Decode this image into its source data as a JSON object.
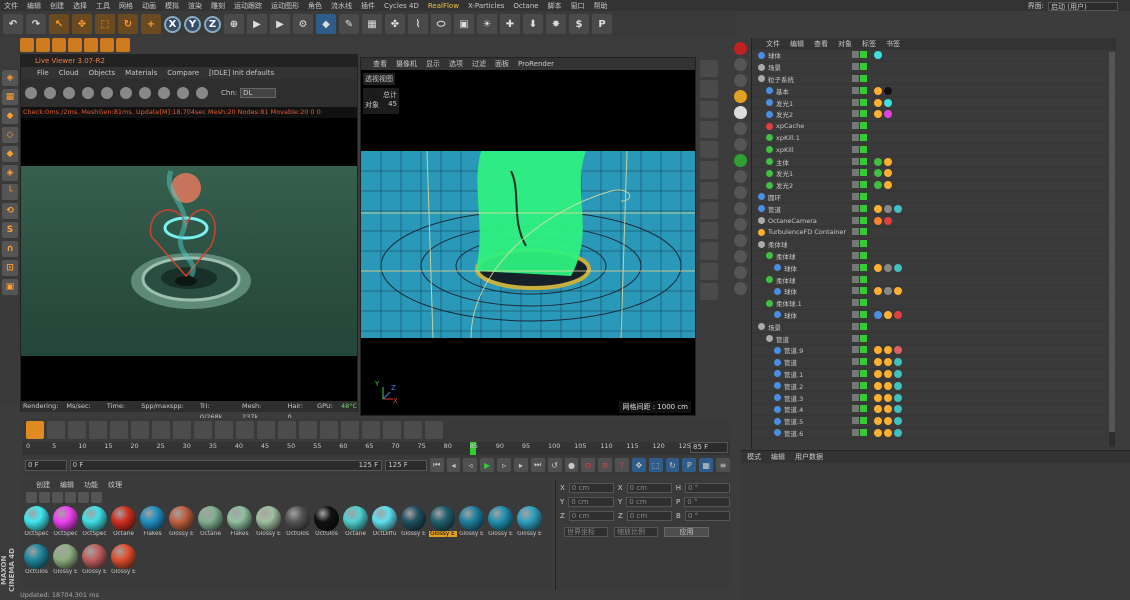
{
  "menubar": {
    "items": [
      "文件",
      "编辑",
      "创建",
      "选择",
      "工具",
      "网格",
      "动画",
      "模拟",
      "渲染",
      "雕刻",
      "运动跟踪",
      "运动图形",
      "角色",
      "流水线",
      "插件",
      "Cycles 4D",
      "RealFlow",
      "X-Particles",
      "Octane",
      "脚本",
      "窗口",
      "帮助"
    ],
    "highlight_index": 16,
    "layout_label": "界面:",
    "layout_value": "启动 (用户)"
  },
  "toolbar": {
    "axes": [
      "X",
      "Y",
      "Z"
    ]
  },
  "live_viewer": {
    "title": "Live Viewer 3.07-R2",
    "menu": [
      "File",
      "Cloud",
      "Objects",
      "Materials",
      "Compare",
      "[IDLE] Init defaults"
    ],
    "chn_label": "Chn:",
    "chn_value": "DL",
    "status": "Check:0ms./2ms. MeshGen:81ms. Update[M]:18.704sec Mesh:20 Nodes:81 Movable:20  0 0",
    "info": {
      "rendering": "Rendering:",
      "ms": "Ms/sec: ...",
      "time": "Time: ...",
      "spp": "Spp/maxspp: ...",
      "tri": "Tri: 0/268k",
      "mesh": "Mesh: 237k",
      "hair": "Hair: 0",
      "gpu": "GPU:",
      "temp": "48°C"
    }
  },
  "viewport": {
    "menu": [
      "查看",
      "摄像机",
      "显示",
      "选项",
      "过滤",
      "面板",
      "ProRender"
    ],
    "label": "透视视图",
    "hud_total": "总计",
    "hud_objects_label": "对象",
    "hud_objects_value": "45",
    "grid_spacing": "网格间距 : 1000 cm",
    "axis_x": "X",
    "axis_y": "Y",
    "axis_z": "Z"
  },
  "object_manager": {
    "menu": [
      "文件",
      "编辑",
      "查看",
      "对象",
      "标签",
      "书签"
    ],
    "rows": [
      {
        "name": "球体",
        "indent": 0,
        "icon": "#4a90e2",
        "tags": [
          "#40e0e0"
        ]
      },
      {
        "name": "场景",
        "indent": 0,
        "icon": "#aaaaaa",
        "tags": []
      },
      {
        "name": "粒子系统",
        "indent": 0,
        "icon": "#aaaaaa",
        "tags": []
      },
      {
        "name": "基本",
        "indent": 1,
        "icon": "#4a90e2",
        "tags": [
          "#ffb030",
          "#111111"
        ]
      },
      {
        "name": "发光1",
        "indent": 1,
        "icon": "#4a90e2",
        "tags": [
          "#ffb030",
          "#40e0e0"
        ]
      },
      {
        "name": "发光2",
        "indent": 1,
        "icon": "#4a90e2",
        "tags": [
          "#ffb030",
          "#e040e0"
        ]
      },
      {
        "name": "xpCache",
        "indent": 1,
        "icon": "#e04040",
        "tags": []
      },
      {
        "name": "xpKill.1",
        "indent": 1,
        "icon": "#40c040",
        "tags": []
      },
      {
        "name": "xpKill",
        "indent": 1,
        "icon": "#40c040",
        "tags": []
      },
      {
        "name": "主体",
        "indent": 1,
        "icon": "#40c040",
        "tags": [
          "#40c040",
          "#ffb030"
        ]
      },
      {
        "name": "发光1",
        "indent": 1,
        "icon": "#40c040",
        "tags": [
          "#40c040",
          "#ffb030"
        ]
      },
      {
        "name": "发光2",
        "indent": 1,
        "icon": "#40c040",
        "tags": [
          "#40c040",
          "#ffb030"
        ]
      },
      {
        "name": "圆环",
        "indent": 0,
        "icon": "#4a90e2",
        "tags": []
      },
      {
        "name": "管道",
        "indent": 0,
        "icon": "#4a90e2",
        "tags": [
          "#ffb030",
          "#888888",
          "#40c0c0"
        ]
      },
      {
        "name": "OctaneCamera",
        "indent": 0,
        "icon": "#aaaaaa",
        "tags": [
          "#ff8030",
          "#e04040"
        ]
      },
      {
        "name": "TurbulenceFD Container",
        "indent": 0,
        "icon": "#ffb030",
        "tags": []
      },
      {
        "name": "柔体球",
        "indent": 0,
        "icon": "#aaaaaa",
        "tags": []
      },
      {
        "name": "柔体球",
        "indent": 1,
        "icon": "#40c040",
        "tags": []
      },
      {
        "name": "球体",
        "indent": 2,
        "icon": "#4a90e2",
        "tags": [
          "#ffb030",
          "#888888",
          "#40c0c0"
        ]
      },
      {
        "name": "柔体球",
        "indent": 1,
        "icon": "#40c040",
        "tags": []
      },
      {
        "name": "球体",
        "indent": 2,
        "icon": "#4a90e2",
        "tags": [
          "#ffb030",
          "#888888",
          "#ffb030"
        ]
      },
      {
        "name": "柔体球.1",
        "indent": 1,
        "icon": "#40c040",
        "tags": []
      },
      {
        "name": "球体",
        "indent": 2,
        "icon": "#4a90e2",
        "tags": [
          "#4a90e2",
          "#ffb030",
          "#e04040"
        ]
      },
      {
        "name": "场景",
        "indent": 0,
        "icon": "#aaaaaa",
        "tags": []
      },
      {
        "name": "管道",
        "indent": 1,
        "icon": "#aaaaaa",
        "tags": []
      },
      {
        "name": "管道.9",
        "indent": 2,
        "icon": "#4a90e2",
        "tags": [
          "#ffb030",
          "#ffb030",
          "#e06060"
        ]
      },
      {
        "name": "管道",
        "indent": 2,
        "icon": "#4a90e2",
        "tags": [
          "#ffb030",
          "#ffb030",
          "#40c0c0"
        ]
      },
      {
        "name": "管道.1",
        "indent": 2,
        "icon": "#4a90e2",
        "tags": [
          "#ffb030",
          "#ffb030",
          "#40c0c0"
        ]
      },
      {
        "name": "管道.2",
        "indent": 2,
        "icon": "#4a90e2",
        "tags": [
          "#ffb030",
          "#ffb030",
          "#40c0c0"
        ]
      },
      {
        "name": "管道.3",
        "indent": 2,
        "icon": "#4a90e2",
        "tags": [
          "#ffb030",
          "#ffb030",
          "#40c0c0"
        ]
      },
      {
        "name": "管道.4",
        "indent": 2,
        "icon": "#4a90e2",
        "tags": [
          "#ffb030",
          "#ffb030",
          "#40c0c0"
        ]
      },
      {
        "name": "管道.5",
        "indent": 2,
        "icon": "#4a90e2",
        "tags": [
          "#ffb030",
          "#ffb030",
          "#40c0c0"
        ]
      },
      {
        "name": "管道.6",
        "indent": 2,
        "icon": "#4a90e2",
        "tags": [
          "#ffb030",
          "#ffb030",
          "#40c0c0"
        ]
      }
    ]
  },
  "attribute_manager": {
    "menu": [
      "模式",
      "编辑",
      "用户数据"
    ]
  },
  "timeline": {
    "ticks": [
      "0",
      "5",
      "10",
      "15",
      "20",
      "25",
      "30",
      "35",
      "40",
      "45",
      "50",
      "55",
      "60",
      "65",
      "70",
      "75",
      "80",
      "85",
      "90",
      "95",
      "100",
      "105",
      "110",
      "115",
      "120",
      "125"
    ],
    "current_frame": "85 F",
    "playhead_frame": 85,
    "start": "0 F",
    "range_start": "0 F",
    "range_end": "125 F",
    "end": "125 F"
  },
  "material_manager": {
    "menu": [
      "创建",
      "编辑",
      "功能",
      "纹理"
    ],
    "materials": [
      {
        "label": "OctSpec",
        "color": "#40e8f0"
      },
      {
        "label": "OctSpec",
        "color": "#f040f0"
      },
      {
        "label": "OctSpec",
        "color": "#40e0e8"
      },
      {
        "label": "Octane",
        "color": "#d03020"
      },
      {
        "label": "Flakes",
        "color": "#2090c0"
      },
      {
        "label": "Glossy E",
        "color": "#c06040"
      },
      {
        "label": "Octane",
        "color": "#80b090"
      },
      {
        "label": "Flakes",
        "color": "#90c0a0"
      },
      {
        "label": "Glossy E",
        "color": "#a0c0a0"
      },
      {
        "label": "OctGlos",
        "color": "#555555"
      },
      {
        "label": "OctGlos",
        "color": "#111111"
      },
      {
        "label": "Octane",
        "color": "#50d0d0"
      },
      {
        "label": "OctDiffu",
        "color": "#60e0f0"
      },
      {
        "label": "Glossy E",
        "color": "#205060"
      },
      {
        "label": "Glossy E",
        "color": "#206070"
      },
      {
        "label": "Glossy E",
        "color": "#2080a0"
      },
      {
        "label": "Glossy E",
        "color": "#2090b0"
      },
      {
        "label": "Glossy E",
        "color": "#30a0c0"
      },
      {
        "label": "OctGlos",
        "color": "#2088a0"
      },
      {
        "label": "Glossy E",
        "color": "#90b080"
      },
      {
        "label": "Glossy E",
        "color": "#c06060"
      },
      {
        "label": "Glossy E",
        "color": "#e05030"
      }
    ],
    "selected_index": 14
  },
  "coordinates": {
    "rows": [
      {
        "a": "X",
        "av": "0 cm",
        "b": "X",
        "bv": "0 cm",
        "c": "H",
        "cv": "0 °"
      },
      {
        "a": "Y",
        "av": "0 cm",
        "b": "Y",
        "bv": "0 cm",
        "c": "P",
        "cv": "0 °"
      },
      {
        "a": "Z",
        "av": "0 cm",
        "b": "Z",
        "bv": "0 cm",
        "c": "B",
        "cv": "0 °"
      }
    ],
    "mode1": "世界坐标",
    "mode2": "缩放比例",
    "apply": "应用"
  },
  "status_bar": "Updated: 18704.301 ms",
  "brand": "MAXON CINEMA 4D"
}
